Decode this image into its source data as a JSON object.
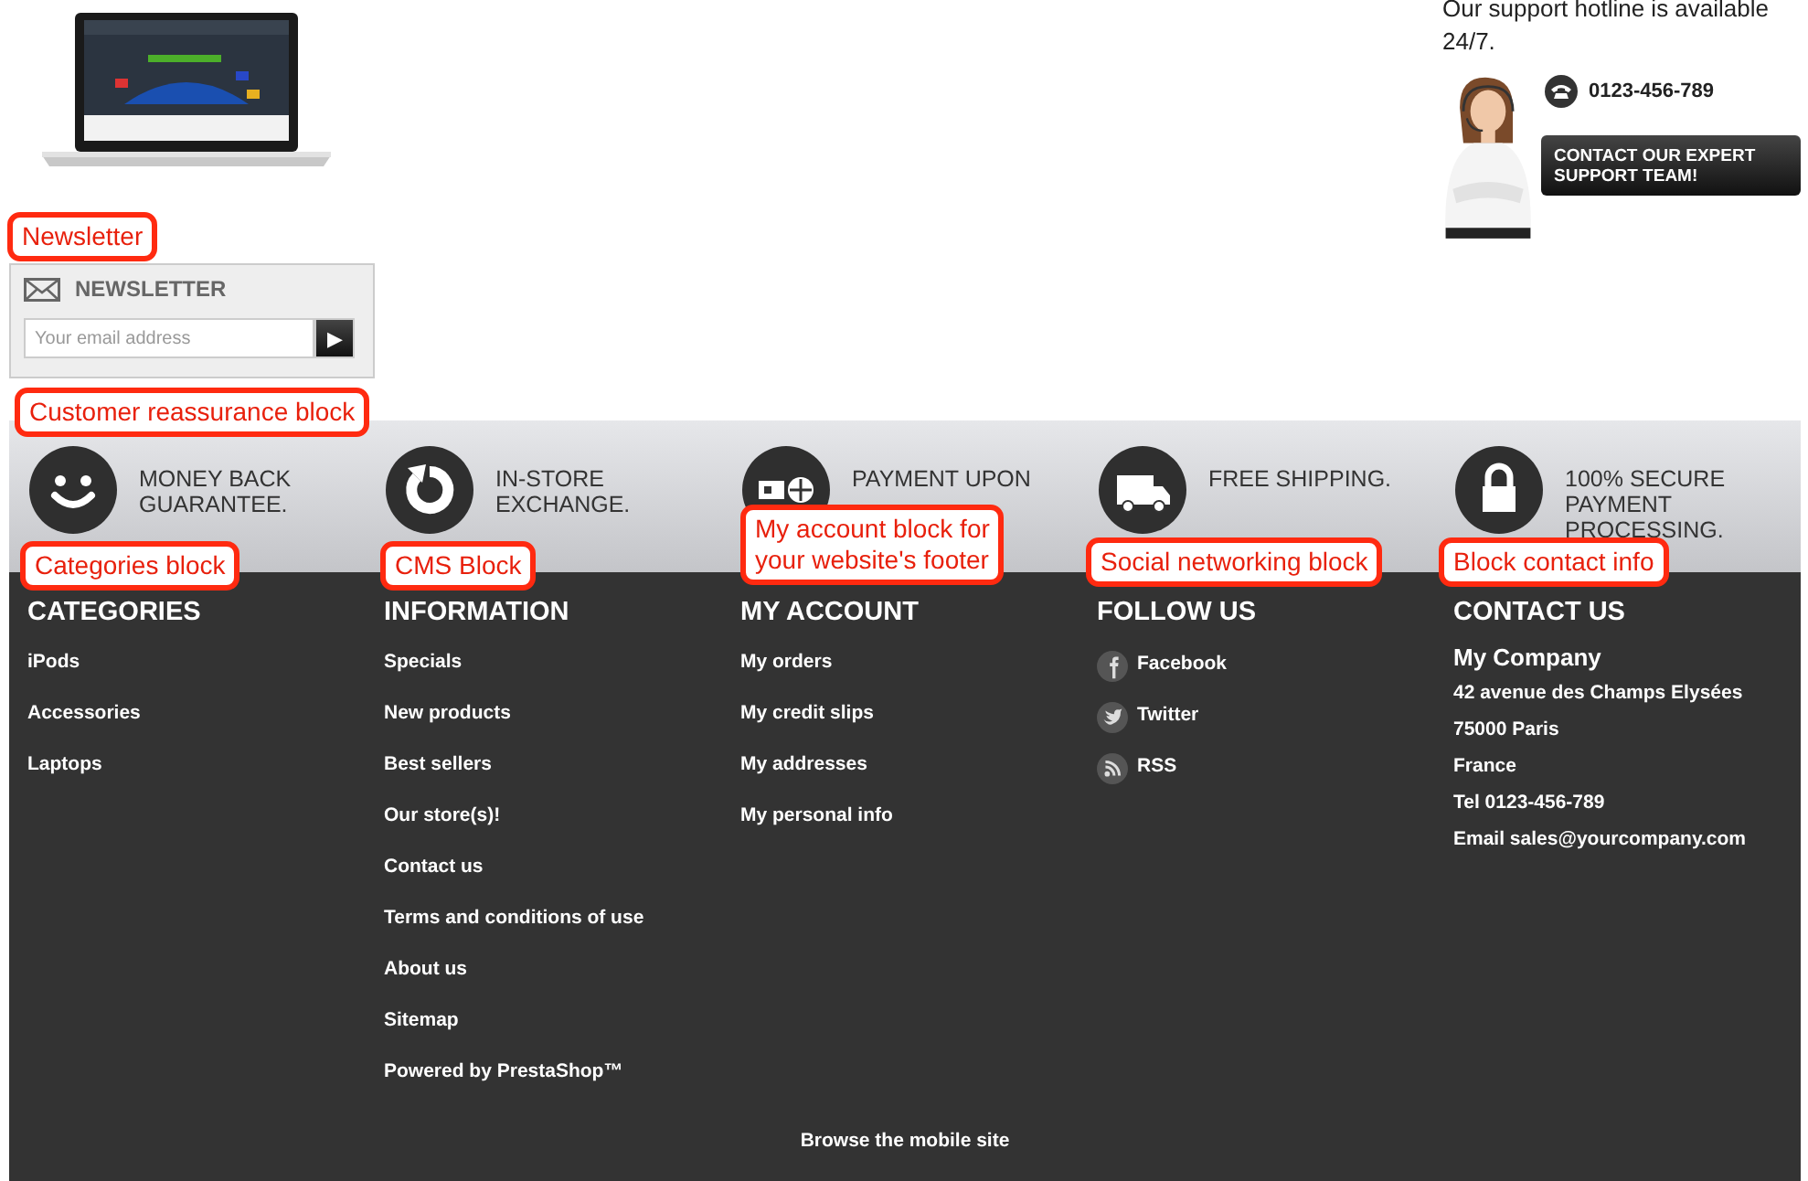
{
  "support": {
    "hotline_text": "Our support hotline is available 24/7.",
    "phone": "0123-456-789",
    "button": "CONTACT OUR EXPERT SUPPORT TEAM!"
  },
  "newsletter": {
    "title": "NEWSLETTER",
    "placeholder": "Your email address",
    "submit": "▶"
  },
  "reassurance": [
    {
      "kind": "smile",
      "lines": [
        "MONEY BACK",
        "GUARANTEE."
      ]
    },
    {
      "kind": "exchange",
      "lines": [
        "IN-STORE",
        "EXCHANGE."
      ]
    },
    {
      "kind": "payment",
      "lines": [
        "PAYMENT UPON"
      ]
    },
    {
      "kind": "truck",
      "lines": [
        "FREE SHIPPING."
      ]
    },
    {
      "kind": "lock",
      "lines": [
        "100% SECURE",
        "PAYMENT",
        "PROCESSING."
      ]
    }
  ],
  "footer": {
    "columns": [
      {
        "kind": "links",
        "title": "CATEGORIES",
        "items": [
          {
            "label": "iPods"
          },
          {
            "label": "Accessories"
          },
          {
            "label": "Laptops"
          }
        ]
      },
      {
        "kind": "links",
        "title": "INFORMATION",
        "items": [
          {
            "label": "Specials"
          },
          {
            "label": "New products"
          },
          {
            "label": "Best sellers"
          },
          {
            "label": "Our store(s)!"
          },
          {
            "label": "Contact us"
          },
          {
            "label": "Terms and conditions of use"
          },
          {
            "label": "About us"
          },
          {
            "label": "Sitemap"
          },
          {
            "label": "Powered by PrestaShop™"
          }
        ]
      },
      {
        "kind": "links",
        "title": "MY ACCOUNT",
        "items": [
          {
            "label": "My orders"
          },
          {
            "label": "My credit slips"
          },
          {
            "label": "My addresses"
          },
          {
            "label": "My personal info"
          }
        ]
      },
      {
        "kind": "social",
        "title": "FOLLOW US",
        "items": [
          {
            "kind": "facebook",
            "label": "Facebook"
          },
          {
            "kind": "twitter",
            "label": "Twitter"
          },
          {
            "kind": "rss",
            "label": "RSS"
          }
        ]
      },
      {
        "kind": "contact",
        "title": "CONTACT US",
        "company": "My Company",
        "lines": [
          "42 avenue des Champs Elysées",
          "75000 Paris",
          "France",
          "Tel 0123-456-789",
          "Email sales@yourcompany.com"
        ]
      }
    ],
    "mobile_link": "Browse the mobile site"
  },
  "callouts": [
    {
      "lines": [
        "Newsletter"
      ]
    },
    {
      "lines": [
        "Customer reassurance block"
      ]
    },
    {
      "lines": [
        "Categories block"
      ]
    },
    {
      "lines": [
        "CMS Block"
      ]
    },
    {
      "lines": [
        "My account block for",
        "your website's footer"
      ]
    },
    {
      "lines": [
        "Social networking block"
      ]
    },
    {
      "lines": [
        "Block contact info"
      ]
    }
  ]
}
